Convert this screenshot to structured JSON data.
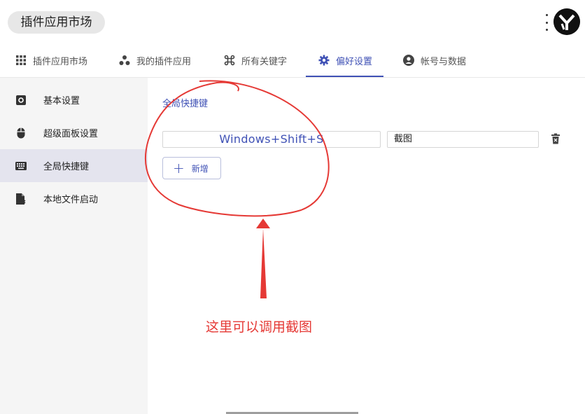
{
  "app": {
    "title": "插件应用市场"
  },
  "tabs": [
    {
      "label": "插件应用市场",
      "icon": "apps-grid-icon"
    },
    {
      "label": "我的插件应用",
      "icon": "bubbles-icon"
    },
    {
      "label": "所有关键字",
      "icon": "command-icon"
    },
    {
      "label": "偏好设置",
      "icon": "gear-icon",
      "active": true
    },
    {
      "label": "帐号与数据",
      "icon": "account-icon"
    }
  ],
  "sidebar": {
    "items": [
      {
        "label": "基本设置",
        "icon": "settings-box-icon"
      },
      {
        "label": "超级面板设置",
        "icon": "mouse-icon"
      },
      {
        "label": "全局快捷键",
        "icon": "keyboard-icon",
        "active": true
      },
      {
        "label": "本地文件启动",
        "icon": "file-launch-icon"
      }
    ]
  },
  "main": {
    "section_title": "全局快捷键",
    "hotkeys": [
      {
        "keys": "Windows+Shift+S",
        "command": "截图"
      }
    ],
    "add_label": "新增"
  },
  "annotation": {
    "text": "这里可以调用截图",
    "color": "#e53935"
  },
  "colors": {
    "accent": "#3f51b5",
    "annotation": "#e53935"
  }
}
